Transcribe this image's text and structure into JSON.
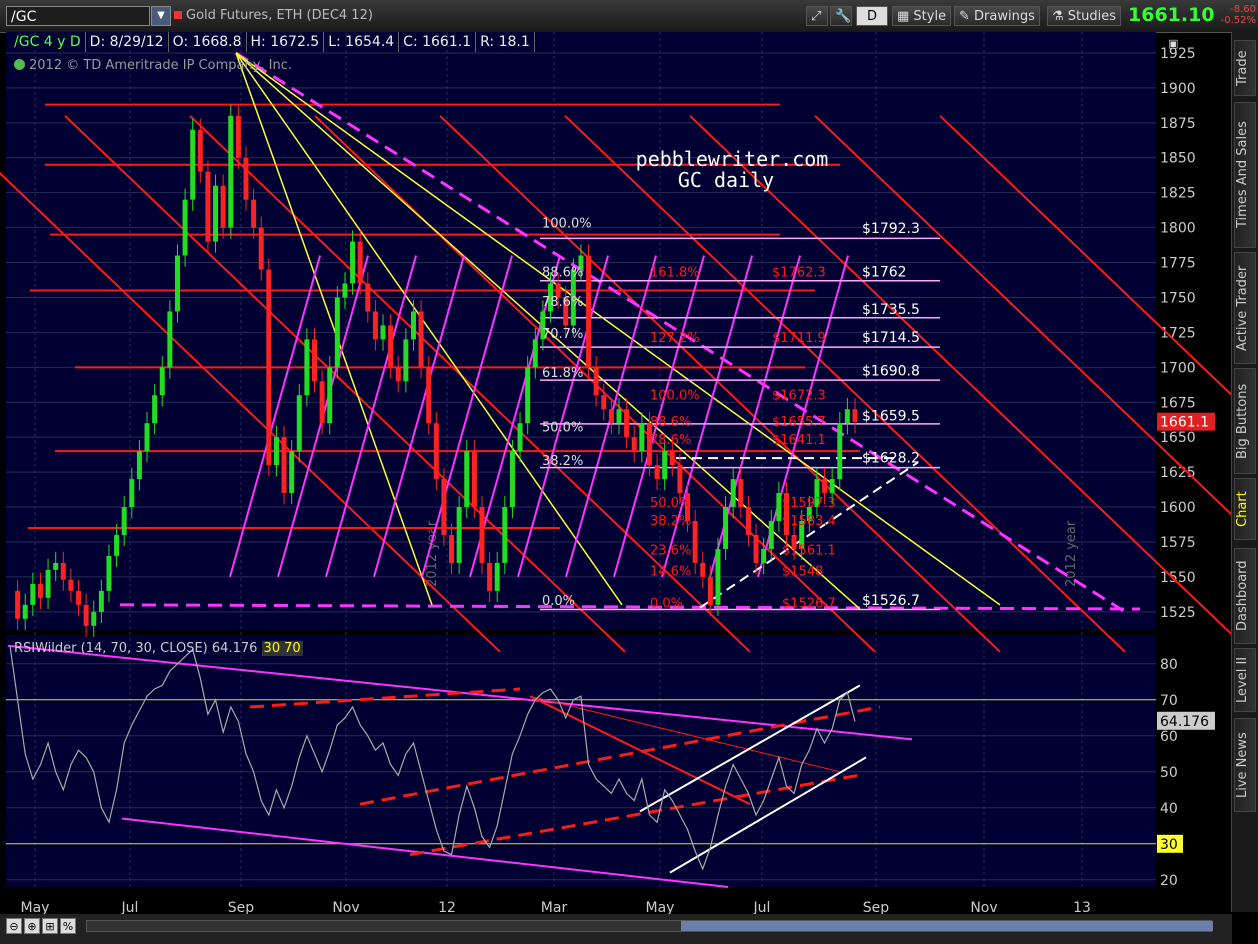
{
  "toolbar": {
    "symbol": "/GC",
    "description": "Gold Futures, ETH (DEC4 12)",
    "period_button": "D",
    "style_label": "Style",
    "drawings_label": "Drawings",
    "studies_label": "Studies",
    "last_price": "1661.10",
    "net_change": "-8.60",
    "pct_change": "-0.52%"
  },
  "infobar": {
    "symbol_period": "/GC 4 y D",
    "date": "D: 8/29/12",
    "open": "O: 1668.8",
    "high": "H: 1672.5",
    "low": "L: 1654.4",
    "close": "C: 1661.1",
    "range": "R: 18.1"
  },
  "copyright": "2012 © TD Ameritrade IP Company, Inc.",
  "watermark": {
    "line1": "pebblewriter.com",
    "line2": "GC daily"
  },
  "rsi_header": {
    "name": "RSIWilder (14, 70, 30, CLOSE)",
    "value": "64.176",
    "oversold": "30",
    "overbought": "70"
  },
  "sidebar_tabs": [
    "Trade",
    "Times And Sales",
    "Active Trader",
    "Big Buttons",
    "Chart",
    "Dashboard",
    "Level II",
    "Live News"
  ],
  "colors": {
    "background": "#000033",
    "grid": "#2a2a5a",
    "red": "#ff1a1a",
    "magenta": "#ff33ff",
    "yellow": "#ffff33",
    "fib_line": "#ffaaff",
    "price_badge": "#e02020"
  },
  "chart_data": {
    "type": "candlestick",
    "x_labels": [
      "May",
      "Jul",
      "Sep",
      "Nov",
      "12",
      "Mar",
      "May",
      "Jul",
      "Sep",
      "Nov",
      "13"
    ],
    "price_axis": {
      "ticks": [
        1525,
        1550,
        1575,
        1600,
        1625,
        1650,
        1675,
        1700,
        1725,
        1750,
        1775,
        1800,
        1825,
        1850,
        1875,
        1900,
        1925
      ],
      "ylim": [
        1512,
        1940
      ]
    },
    "last_price_badge": "1661.1",
    "series": [
      {
        "name": "GC daily close",
        "values": [
          1540,
          1520,
          1530,
          1545,
          1535,
          1555,
          1560,
          1548,
          1540,
          1530,
          1515,
          1525,
          1540,
          1565,
          1580,
          1600,
          1620,
          1640,
          1660,
          1680,
          1700,
          1740,
          1780,
          1820,
          1870,
          1840,
          1790,
          1830,
          1800,
          1880,
          1850,
          1820,
          1800,
          1770,
          1630,
          1650,
          1610,
          1640,
          1680,
          1720,
          1690,
          1660,
          1700,
          1750,
          1760,
          1790,
          1760,
          1740,
          1720,
          1730,
          1700,
          1690,
          1720,
          1740,
          1700,
          1660,
          1620,
          1580,
          1560,
          1600,
          1640,
          1600,
          1560,
          1540,
          1560,
          1600,
          1640,
          1660,
          1700,
          1720,
          1740,
          1760,
          1750,
          1730,
          1770,
          1780,
          1700,
          1680,
          1670,
          1660,
          1670,
          1650,
          1640,
          1660,
          1630,
          1620,
          1640,
          1630,
          1610,
          1590,
          1560,
          1550,
          1530,
          1570,
          1600,
          1620,
          1600,
          1580,
          1560,
          1570,
          1590,
          1610,
          1580,
          1570,
          1590,
          1600,
          1620,
          1610,
          1620,
          1660,
          1670,
          1661
        ]
      }
    ],
    "fib_levels_left": [
      "100.0%",
      "88.6%",
      "78.6%",
      "70.7%",
      "61.8%",
      "50.0%",
      "38.2%",
      "0.0%"
    ],
    "fib_levels_inner": [
      "161.8%",
      "127.2%",
      "100.0%",
      "88.6%",
      "78.6%",
      "50.0%",
      "38.2%",
      "23.6%",
      "14.6%",
      "0.0%"
    ],
    "fib_inner_prices": [
      "$1762.3",
      "$1711.9",
      "$1672.3",
      "$1655.7",
      "$1641.1",
      "$1597.3",
      "$1583.4",
      "$1561.1",
      "$1548",
      "$1526.7"
    ],
    "fib_price_labels": [
      "$1792.3",
      "$1762",
      "$1735.5",
      "$1714.5",
      "$1690.8",
      "$1659.5",
      "$1628.2",
      "$1526.7"
    ],
    "year_markers": [
      "2012 year",
      "2012 year"
    ]
  },
  "rsi_data": {
    "type": "line",
    "ticks": [
      20,
      30,
      40,
      50,
      60,
      70,
      80
    ],
    "ylim": [
      18,
      88
    ],
    "current_value": "64.176",
    "oversold_badge": "30",
    "series": [
      {
        "name": "RSIWilder",
        "values": [
          85,
          70,
          55,
          48,
          52,
          58,
          50,
          45,
          52,
          56,
          54,
          50,
          40,
          36,
          45,
          58,
          63,
          67,
          71,
          73,
          74,
          78,
          80,
          82,
          84,
          76,
          66,
          70,
          61,
          68,
          64,
          55,
          50,
          42,
          38,
          45,
          40,
          46,
          54,
          60,
          55,
          50,
          56,
          63,
          65,
          68,
          63,
          60,
          56,
          58,
          52,
          49,
          55,
          58,
          50,
          42,
          34,
          28,
          27,
          38,
          46,
          40,
          32,
          29,
          35,
          45,
          55,
          60,
          66,
          70,
          72,
          73,
          70,
          65,
          70,
          71,
          52,
          48,
          46,
          44,
          48,
          44,
          42,
          48,
          38,
          36,
          45,
          42,
          38,
          34,
          28,
          23,
          29,
          38,
          46,
          52,
          48,
          44,
          38,
          42,
          48,
          54,
          46,
          44,
          52,
          56,
          62,
          58,
          62,
          70,
          72,
          64
        ]
      }
    ]
  }
}
